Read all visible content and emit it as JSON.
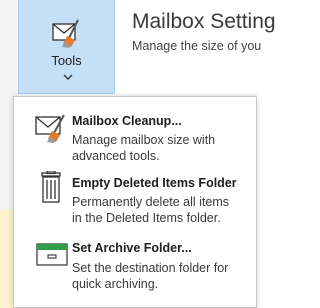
{
  "ribbon": {
    "tools_label": "Tools",
    "tools_icon": "tools-icon",
    "chevron_icon": "chevron-down-icon",
    "accent_color": "#c5dff7"
  },
  "mailbox": {
    "title": "Mailbox Setting",
    "subtitle": "Manage the size of you"
  },
  "menu": {
    "items": [
      {
        "icon": "mailbox-cleanup-icon",
        "title": "Mailbox Cleanup...",
        "desc_line1": "Manage mailbox size with",
        "desc_line2": "advanced tools."
      },
      {
        "icon": "trash-icon",
        "title": "Empty Deleted Items Folder",
        "desc_line1": "Permanently delete all items",
        "desc_line2": "in the Deleted Items folder."
      },
      {
        "icon": "archive-folder-icon",
        "title": "Set Archive Folder...",
        "desc_line1": "Set the destination folder for",
        "desc_line2": "quick archiving."
      }
    ]
  }
}
